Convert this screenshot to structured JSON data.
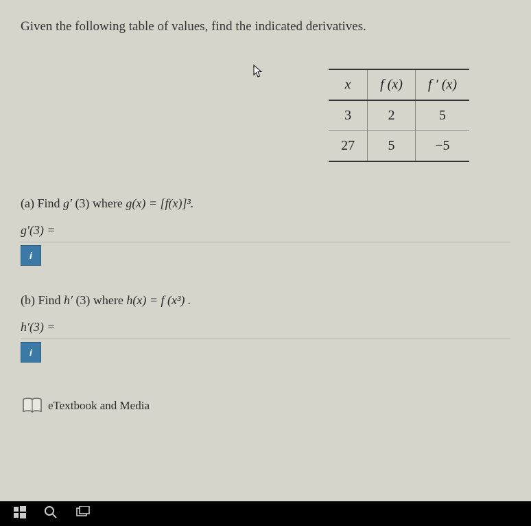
{
  "prompt": "Given the following table of values, find the indicated derivatives.",
  "table": {
    "headers": {
      "c0": "x",
      "c1": "f (x)",
      "c2": "f ′ (x)"
    },
    "rows": [
      {
        "c0": "3",
        "c1": "2",
        "c2": "5"
      },
      {
        "c0": "27",
        "c1": "5",
        "c2": "−5"
      }
    ]
  },
  "parts": {
    "a": {
      "text_prefix": "(a) Find ",
      "g_prime": "g′",
      "arg": " (3) where ",
      "g_eq": "g(x) = [f(x)]³.",
      "answer_label": "g′(3) ="
    },
    "b": {
      "text_prefix": "(b) Find ",
      "h_prime": "h′",
      "arg": " (3) where ",
      "h_eq": "h(x) = f (x³) .",
      "answer_label": "h′(3) ="
    }
  },
  "info_label": "i",
  "textbook_label": "eTextbook and Media",
  "chart_data": {
    "type": "table",
    "columns": [
      "x",
      "f(x)",
      "f'(x)"
    ],
    "rows": [
      [
        3,
        2,
        5
      ],
      [
        27,
        5,
        -5
      ]
    ]
  }
}
